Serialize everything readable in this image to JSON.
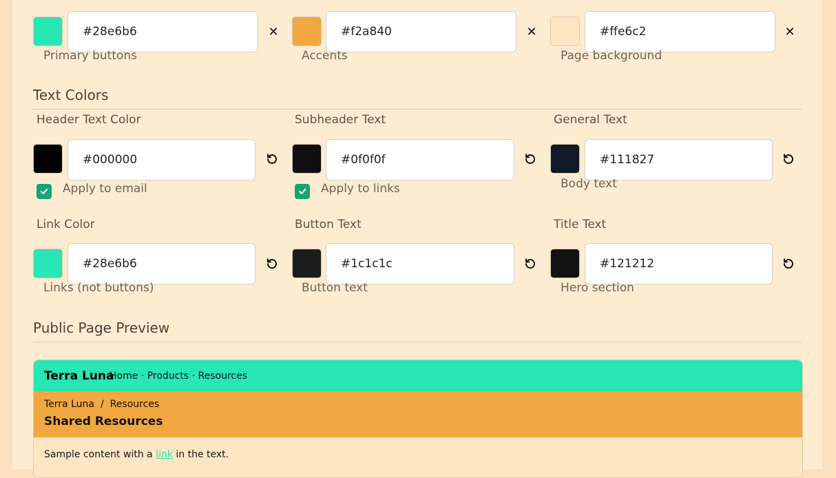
{
  "brand_colors": [
    {
      "id": "primary",
      "value": "#28e6b6",
      "hint": "Primary buttons",
      "color": "#28e6b6"
    },
    {
      "id": "accent",
      "value": "#f2a840",
      "hint": "Accents",
      "color": "#f2a840"
    },
    {
      "id": "background",
      "value": "#ffe6c2",
      "hint": "Page background",
      "color": "#ffe6c2"
    }
  ],
  "text_colors": {
    "section_title": "Text Colors",
    "header": {
      "label": "Header Text Color",
      "value": "#000000",
      "color": "#000000",
      "checkbox_label": "Apply to email",
      "checked": true
    },
    "subheader": {
      "label": "Subheader Text",
      "value": "#0f0f0f",
      "color": "#0f0f0f",
      "checkbox_label": "Apply to links",
      "checked": true
    },
    "general": {
      "label": "General Text",
      "value": "#111827",
      "color": "#111827",
      "hint": "Body text"
    },
    "link": {
      "label": "Link Color",
      "value": "#28e6b6",
      "color": "#28e6b6",
      "hint": "Links (not buttons)"
    },
    "button": {
      "label": "Button Text",
      "value": "#1c1c1c",
      "color": "#1c1c1c",
      "hint": "Button text"
    },
    "title": {
      "label": "Title Text",
      "value": "#121212",
      "color": "#121212",
      "hint": "Hero section"
    }
  },
  "preview": {
    "section_title": "Public Page Preview",
    "brand": "Terra Luna",
    "nav": [
      "Home",
      "Products",
      "Resources"
    ],
    "breadcrumb": [
      "Terra Luna",
      "Resources"
    ],
    "heading": "Shared Resources",
    "body_before": "Sample content with a ",
    "link_text": "link",
    "body_after": " in the text.",
    "nav_bg": "#28e6b6",
    "hero_bg": "#f2a840"
  },
  "icons": {
    "clear": "close-icon",
    "reset": "reset-icon",
    "check": "check-icon"
  }
}
